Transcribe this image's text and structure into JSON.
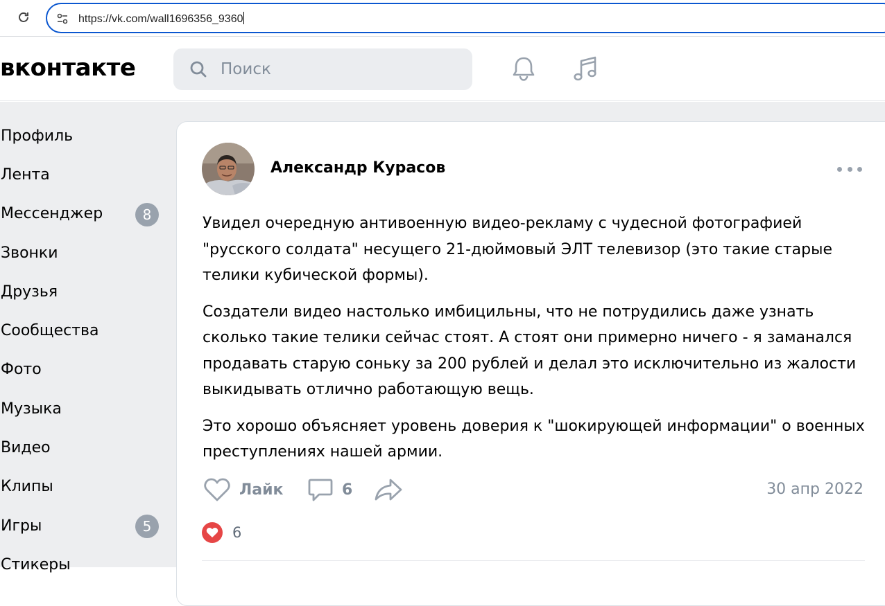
{
  "browser": {
    "url": "https://vk.com/wall1696356_9360"
  },
  "header": {
    "logo": "вконтакте",
    "search_placeholder": "Поиск"
  },
  "sidebar": {
    "items": [
      {
        "label": "Профиль",
        "badge": ""
      },
      {
        "label": "Лента",
        "badge": ""
      },
      {
        "label": "Мессенджер",
        "badge": "8"
      },
      {
        "label": "Звонки",
        "badge": ""
      },
      {
        "label": "Друзья",
        "badge": ""
      },
      {
        "label": "Сообщества",
        "badge": ""
      },
      {
        "label": "Фото",
        "badge": ""
      },
      {
        "label": "Музыка",
        "badge": ""
      },
      {
        "label": "Видео",
        "badge": ""
      },
      {
        "label": "Клипы",
        "badge": ""
      },
      {
        "label": "Игры",
        "badge": "5"
      },
      {
        "label": "Стикеры",
        "badge": ""
      }
    ]
  },
  "post": {
    "author": "Александр Курасов",
    "paragraphs": [
      "Увидел очередную антивоенную видео-рекламу с чудесной фотографией \"русского солдата\" несущего 21-дюймовый ЭЛТ телевизор (это такие старые телики кубической формы).",
      "Создатели видео настолько имбицильны, что не потрудились даже узнать сколько такие телики сейчас стоят. А стоят они примерно ничего - я заманался продавать старую соньку за 200 рублей и делал это исключительно из жалости выкидывать отлично работающую вещь.",
      "Это хорошо объясняет уровень доверия к \"шокирующей информации\" о военных преступлениях нашей армии."
    ],
    "like_label": "Лайк",
    "comment_count": "6",
    "date": "30 апр 2022",
    "reaction_count": "6"
  },
  "colors": {
    "accent_blue": "#0b57d0",
    "reaction_red": "#e64646",
    "muted_gray": "#818c99",
    "badge_gray": "#99a2ad",
    "page_bg": "#edeef0"
  }
}
